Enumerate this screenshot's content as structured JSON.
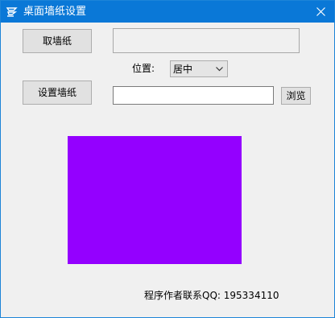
{
  "window": {
    "title": "桌面墙纸设置",
    "close_glyph": "✕"
  },
  "buttons": {
    "cancel_wallpaper": "取墙纸",
    "set_wallpaper": "设置墙纸",
    "browse": "浏览"
  },
  "position": {
    "label": "位置:",
    "selected": "居中"
  },
  "path_field": {
    "value": ""
  },
  "preview": {
    "color": "#9400ff"
  },
  "footer": {
    "author_label": "程序作者联系QQ:",
    "qq_number": "195334110"
  },
  "colors": {
    "titlebar": "#0a78d7",
    "window_border": "#1c84d8",
    "dialog_bg": "#f0f0f0"
  }
}
